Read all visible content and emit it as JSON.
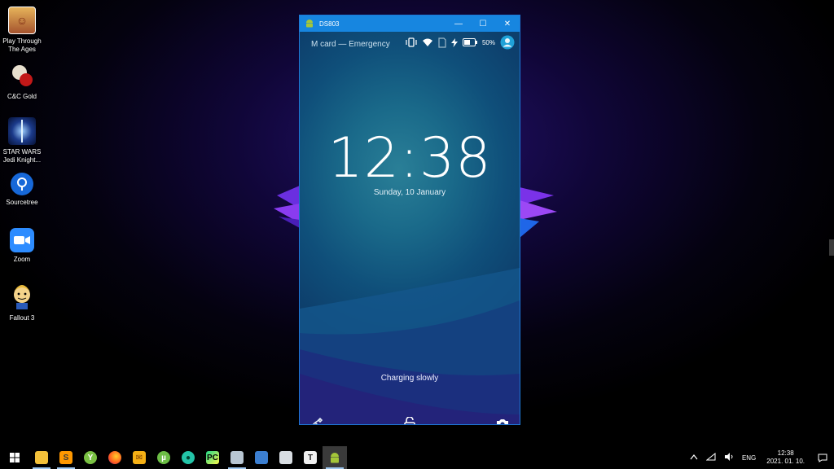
{
  "desktop": {
    "icons": [
      {
        "label": "Play Through The Ages",
        "icon": "play-through-the-ages-icon"
      },
      {
        "label": "C&C Gold",
        "icon": "cnc-gold-icon"
      },
      {
        "label": "STAR WARS Jedi Knight...",
        "icon": "star-wars-icon"
      },
      {
        "label": "Sourcetree",
        "icon": "sourcetree-icon"
      },
      {
        "label": "Zoom",
        "icon": "zoom-icon"
      },
      {
        "label": "Fallout 3",
        "icon": "fallout-icon"
      }
    ]
  },
  "emulator": {
    "title": "DS803",
    "controls": {
      "minimize": "—",
      "maximize": "☐",
      "close": "✕"
    },
    "status": {
      "carrier": "M card — Emergency",
      "battery_pct": "50%"
    },
    "lockscreen": {
      "time": "12:38",
      "date": "Sunday, 10 January",
      "charging": "Charging slowly"
    }
  },
  "taskbar": {
    "apps": [
      "file-explorer-icon",
      "sublime-text-icon",
      "app-y-icon",
      "firefox-icon",
      "mail-icon",
      "utorrent-icon",
      "gitkraken-icon",
      "pycharm-icon",
      "screen-tool-icon",
      "remote-tool-icon",
      "vm-tool-icon",
      "typora-icon",
      "android-emulator-icon"
    ],
    "tray": {
      "language": "ENG",
      "time": "12:38",
      "date": "2021. 01. 10."
    }
  },
  "colors": {
    "accent": "#1786e0",
    "screen": "#0f4f7a",
    "taskbar": "#000000"
  }
}
